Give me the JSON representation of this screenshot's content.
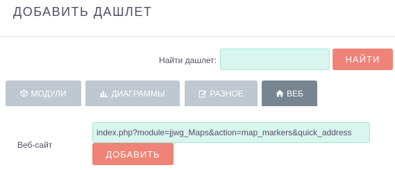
{
  "dialog": {
    "title": "ДОБАВИТЬ ДАШЛЕТ"
  },
  "search": {
    "label": "Найти дашлет:",
    "value": "",
    "placeholder": "",
    "button_label": "НАЙТИ"
  },
  "tabs": [
    {
      "label": "МОДУЛИ",
      "icon": "cube-icon",
      "active": false
    },
    {
      "label": "ДИАГРАММЫ",
      "icon": "bar-chart-icon",
      "active": false
    },
    {
      "label": "РАЗНОЕ",
      "icon": "edit-icon",
      "active": false
    },
    {
      "label": "ВЕБ",
      "icon": "home-icon",
      "active": true
    }
  ],
  "web": {
    "website_label": "Веб-сайт",
    "url_value": "index.php?module=jjwg_Maps&action=map_markers&quick_address",
    "add_button_label": "ДОБАВИТЬ"
  },
  "colors": {
    "accent_button": "#f08377",
    "input_background": "#d8f5ee",
    "tab_inactive": "#bfc8d0",
    "tab_active": "#778591",
    "text": "#534d64"
  }
}
